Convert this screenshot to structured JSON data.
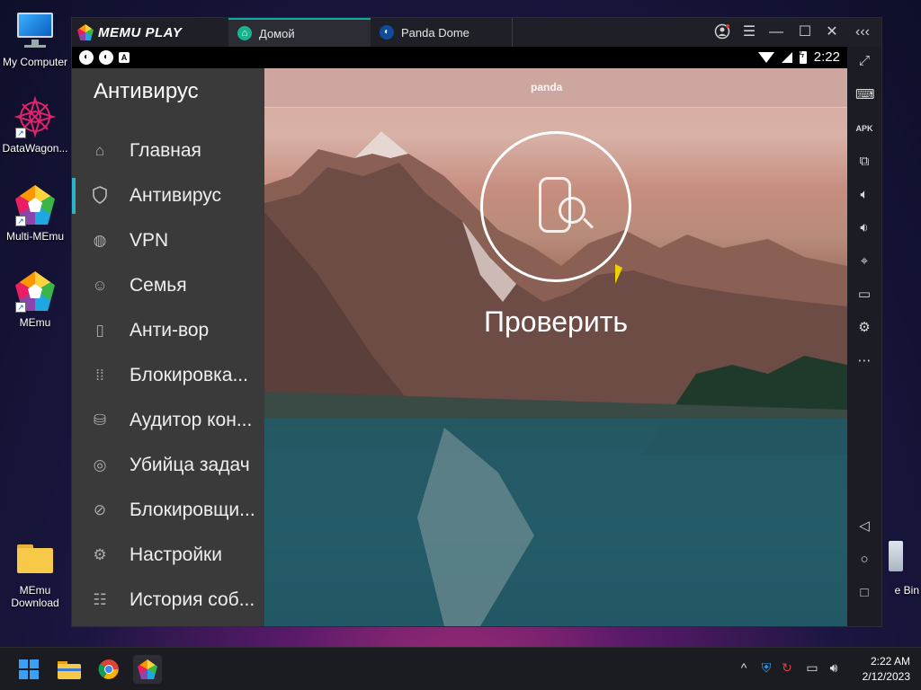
{
  "desktop": {
    "icons": [
      {
        "label": "My Computer"
      },
      {
        "label": "DataWagon..."
      },
      {
        "label": "Multi-MEmu"
      },
      {
        "label": "MEmu"
      },
      {
        "label": "MEmu\nDownload"
      },
      {
        "label": "e Bin"
      }
    ]
  },
  "window": {
    "app_name": "MEMU PLAY",
    "tabs": [
      {
        "label": "Домой",
        "active": true
      },
      {
        "label": "Panda Dome",
        "active": false
      }
    ],
    "controls": [
      "account-icon",
      "menu-icon",
      "minimize-icon",
      "maximize-icon",
      "close-icon",
      "collapse-icon"
    ]
  },
  "statusbar": {
    "time": "2:22",
    "left_icons": [
      "panda-notification-icon",
      "panda-notification-icon",
      "a-notification-icon"
    ]
  },
  "drawer": {
    "title": "Антивирус",
    "items": [
      {
        "label": "Главная",
        "icon": "home-icon",
        "active": false
      },
      {
        "label": "Антивирус",
        "icon": "shield-icon",
        "active": true
      },
      {
        "label": "VPN",
        "icon": "globe-icon",
        "active": false
      },
      {
        "label": "Семья",
        "icon": "family-icon",
        "active": false
      },
      {
        "label": "Анти-вор",
        "icon": "phone-icon",
        "active": false
      },
      {
        "label": "Блокировка...",
        "icon": "grid-icon",
        "active": false
      },
      {
        "label": "Аудитор кон...",
        "icon": "database-icon",
        "active": false
      },
      {
        "label": "Убийца задач",
        "icon": "target-icon",
        "active": false
      },
      {
        "label": "Блокировщи...",
        "icon": "block-icon",
        "active": false
      },
      {
        "label": "Настройки",
        "icon": "gear-icon",
        "active": false
      },
      {
        "label": "История соб...",
        "icon": "list-icon",
        "active": false
      }
    ]
  },
  "main": {
    "brand": "panda",
    "scan_button_label": "Проверить"
  },
  "toolbar": {
    "items": [
      "fullscreen-icon",
      "keyboard-icon",
      "apk-icon",
      "add-window-icon",
      "volume-up-icon",
      "volume-down-icon",
      "location-icon",
      "folder-icon",
      "settings-icon",
      "more-icon",
      "back-icon",
      "home-nav-icon",
      "recents-icon"
    ]
  },
  "taskbar": {
    "time": "2:22 AM",
    "date": "2/12/2023"
  }
}
